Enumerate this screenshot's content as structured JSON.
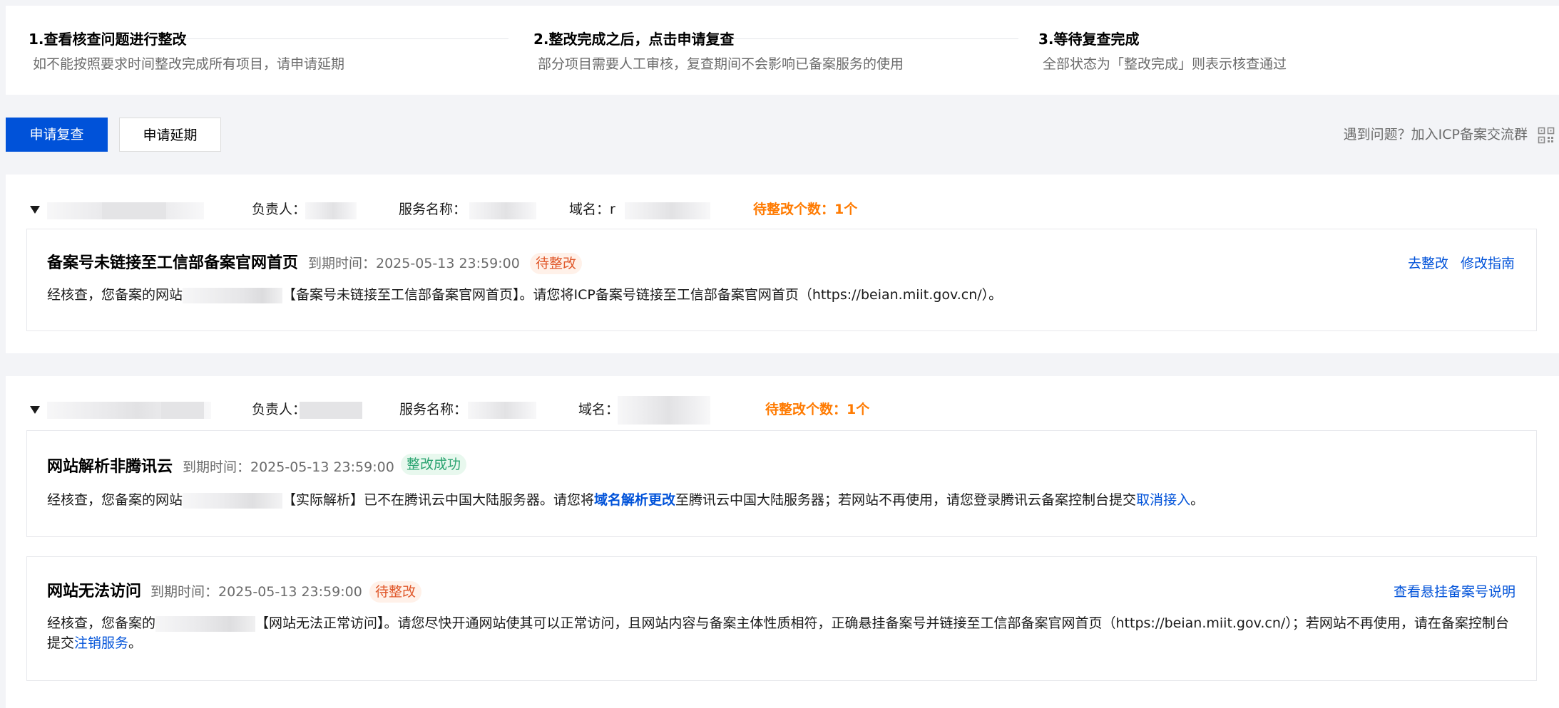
{
  "steps": [
    {
      "title": "1.查看核查问题进行整改",
      "desc": "如不能按照要求时间整改完成所有项目，请申请延期"
    },
    {
      "title": "2.整改完成之后，点击申请复查",
      "desc": "部分项目需要人工审核，复查期间不会影响已备案服务的使用"
    },
    {
      "title": "3.等待复查完成",
      "desc": "全部状态为「整改完成」则表示核查通过"
    }
  ],
  "actions": {
    "request_review": "申请复查",
    "request_extension": "申请延期",
    "help": "遇到问题？加入ICP备案交流群",
    "qr_icon": "qrcode-icon"
  },
  "groups": [
    {
      "owner_label": "负责人：",
      "service_label": "服务名称：",
      "domain_label": "域名：",
      "domain_prefix": "r",
      "pending": "待整改个数：1个",
      "cards": [
        {
          "title": "备案号未链接至工信部备案官网首页",
          "due": "到期时间：2025-05-13 23:59:00",
          "status": "待整改",
          "status_color": "#e0582a",
          "desc_prefix": "经核查，您备案的网站",
          "desc_suffix": "【备案号未链接至工信部备案官网首页】。请您将ICP备案号链接至工信部备案官网首页（https://beian.miit.gov.cn/）。",
          "action_primary": "去整改",
          "action_secondary": "修改指南"
        }
      ]
    },
    {
      "owner_label": "负责人：",
      "service_label": "服务名称：",
      "domain_label": "域名：",
      "pending": "待整改个数：1个",
      "cards": [
        {
          "title": "网站解析非腾讯云",
          "due": "到期时间：2025-05-13 23:59:00",
          "status": "整改成功",
          "status_color": "#2ba471",
          "desc_prefix": "经核查，您备案的网站",
          "desc_mid1": "【实际解析】已不在腾讯云中国大陆服务器。请您将",
          "desc_link1": "域名解析更改",
          "desc_mid2": "至腾讯云中国大陆服务器；若网站不再使用，请您登录腾讯云备案控制台提交",
          "desc_link2": "取消接入",
          "desc_end": "。"
        },
        {
          "title": "网站无法访问",
          "due": "到期时间：2025-05-13 23:59:00",
          "status": "待整改",
          "status_color": "#e0582a",
          "desc_prefix": "经核查，您备案的",
          "desc_line1": "【网站无法正常访问】。请您尽快开通网站使其可以正常访问，且网站内容与备案主体性质相符，正确悬挂备案号并链接至工信部备案官网首页（https://beian.miit.gov.cn/）；若网站不再使用，请在备案控制台",
          "desc_line2_prefix": "提交",
          "desc_link": "注销服务",
          "desc_end": "。",
          "action_primary": "查看悬挂备案号说明"
        }
      ]
    }
  ]
}
